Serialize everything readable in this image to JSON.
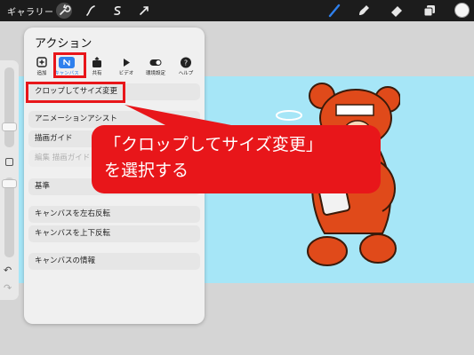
{
  "topbar": {
    "gallery_label": "ギャラリー",
    "tools": [
      "wrench-icon",
      "magic-wand-icon",
      "selection-icon",
      "transform-arrow-icon"
    ],
    "right_tools": [
      "brush-icon",
      "smudge-icon",
      "eraser-icon",
      "layers-icon"
    ],
    "current_color": "#f6f6f6"
  },
  "panel": {
    "title": "アクション",
    "tabs": [
      {
        "label": "追加",
        "icon": "add-icon"
      },
      {
        "label": "キャンバス",
        "icon": "canvas-icon",
        "active": true
      },
      {
        "label": "共有",
        "icon": "share-icon"
      },
      {
        "label": "ビデオ",
        "icon": "video-icon"
      },
      {
        "label": "環境設定",
        "icon": "toggle-icon"
      },
      {
        "label": "ヘルプ",
        "icon": "help-icon"
      }
    ],
    "items": {
      "crop_resize": "クロップしてサイズ変更",
      "animation_assist": "アニメーションアシスト",
      "drawing_guide": "描画ガイド",
      "edit_drawing_guide": "編集 描画ガイド",
      "reference": "基準",
      "flip_horizontal": "キャンバスを左右反転",
      "flip_vertical": "キャンバスを上下反転",
      "canvas_info": "キャンバスの情報"
    }
  },
  "callout": {
    "line1": "「クロップしてサイズ変更」",
    "line2": "を選択する"
  },
  "colors": {
    "highlight_red": "#e8161a",
    "accent_blue": "#2f80ed",
    "artboard": "#a6e6f7"
  }
}
